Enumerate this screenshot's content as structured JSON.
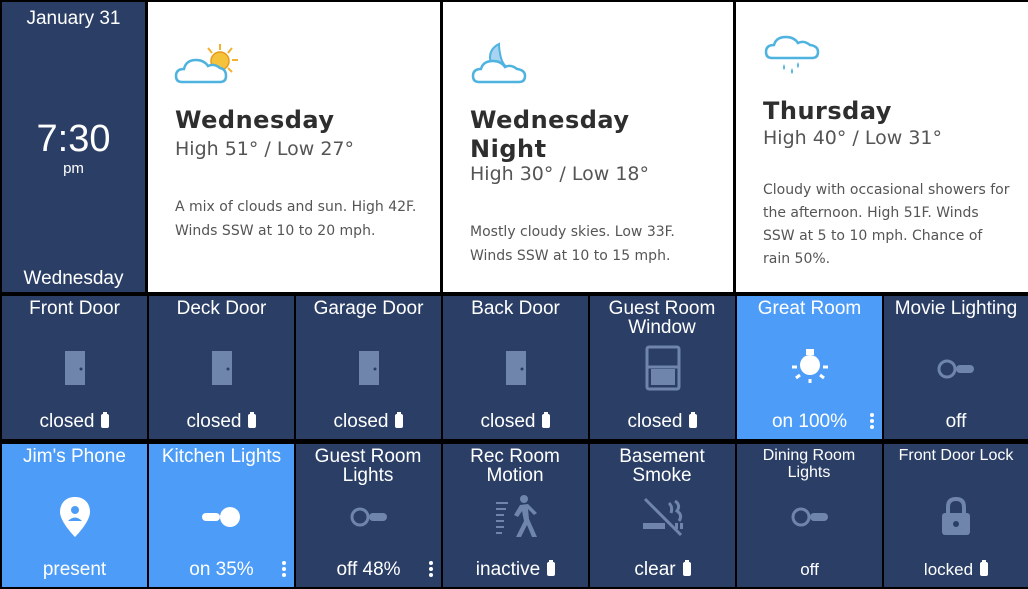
{
  "clock": {
    "date": "January 31",
    "time": "7:30",
    "ampm": "pm",
    "weekday": "Wednesday"
  },
  "forecast": [
    {
      "icon": "partly-cloudy-sun-icon",
      "title": "Wednesday",
      "temps": "High 51° / Low 27°",
      "desc": "A mix of clouds and sun. High 42F. Winds SSW at 10 to 20 mph."
    },
    {
      "icon": "cloudy-night-moon-icon",
      "title": "Wednesday Night",
      "temps": "High 30° / Low 18°",
      "desc": "Mostly cloudy skies. Low 33F. Winds SSW at 10 to 15 mph."
    },
    {
      "icon": "rain-cloud-icon",
      "title": "Thursday",
      "temps": "High 40° / Low 31°",
      "desc": "Cloudy with occasional showers for the afternoon. High 51F. Winds SSW at 5 to 10 mph. Chance of rain 50%."
    }
  ],
  "colors": {
    "tile": "#2b3f66",
    "tile_active": "#4d9df8",
    "icon_dim": "#6f85ab"
  },
  "tiles_row1": [
    {
      "name": "Front Door",
      "state": "closed",
      "icon": "door-icon"
    },
    {
      "name": "Deck Door",
      "state": "closed",
      "icon": "door-icon"
    },
    {
      "name": "Garage Door",
      "state": "closed",
      "icon": "door-icon"
    },
    {
      "name": "Back Door",
      "state": "closed",
      "icon": "door-icon"
    },
    {
      "name": "Guest Room Window",
      "state": "closed",
      "icon": "window-icon"
    },
    {
      "name": "Great Room",
      "state": "on 100%",
      "icon": "light-bulb-icon"
    },
    {
      "name": "Movie Lighting",
      "state": "off",
      "icon": "switch-off-icon"
    }
  ],
  "tiles_row2": [
    {
      "name": "Jim's Phone",
      "state": "present",
      "icon": "location-pin-icon"
    },
    {
      "name": "Kitchen Lights",
      "state": "on 35%",
      "icon": "switch-on-icon"
    },
    {
      "name": "Guest Room Lights",
      "state": "off 48%",
      "icon": "switch-off-icon"
    },
    {
      "name": "Rec Room Motion",
      "state": "inactive",
      "icon": "motion-walker-icon"
    },
    {
      "name": "Basement Smoke",
      "state": "clear",
      "icon": "no-smoke-icon"
    },
    {
      "name": "Dining Room Lights",
      "state": "off",
      "icon": "switch-off-icon"
    },
    {
      "name": "Front Door Lock",
      "state": "locked",
      "icon": "padlock-icon"
    }
  ]
}
